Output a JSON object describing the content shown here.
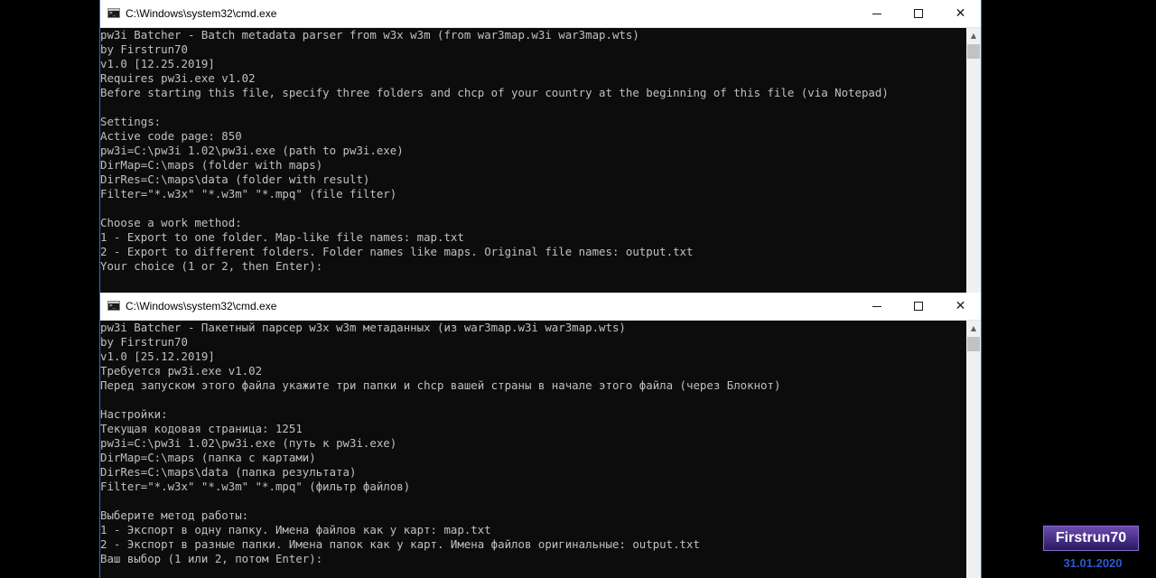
{
  "windows": [
    {
      "title": "C:\\Windows\\system32\\cmd.exe",
      "controls": {
        "minimize": "",
        "maximize": "",
        "close": "✕"
      },
      "lines": [
        "pw3i Batcher - Batch metadata parser from w3x w3m (from war3map.w3i war3map.wts)",
        "by Firstrun70",
        "v1.0 [12.25.2019]",
        "Requires pw3i.exe v1.02",
        "Before starting this file, specify three folders and chcp of your country at the beginning of this file (via Notepad)",
        "",
        "Settings:",
        "Active code page: 850",
        "pw3i=C:\\pw3i 1.02\\pw3i.exe (path to pw3i.exe)",
        "DirMap=C:\\maps (folder with maps)",
        "DirRes=C:\\maps\\data (folder with result)",
        "Filter=\"*.w3x\" \"*.w3m\" \"*.mpq\" (file filter)",
        "",
        "Choose a work method:",
        "1 - Export to one folder. Map-like file names: map.txt",
        "2 - Export to different folders. Folder names like maps. Original file names: output.txt",
        "Your choice (1 or 2, then Enter):"
      ]
    },
    {
      "title": "C:\\Windows\\system32\\cmd.exe",
      "controls": {
        "minimize": "",
        "maximize": "",
        "close": "✕"
      },
      "lines": [
        "pw3i Batcher - Пакетный парсер w3x w3m метаданных (из war3map.w3i war3map.wts)",
        "by Firstrun70",
        "v1.0 [25.12.2019]",
        "Требуется pw3i.exe v1.02",
        "Перед запуском этого файла укажите три папки и chcp вашей страны в начале этого файла (через Блокнот)",
        "",
        "Настройки:",
        "Текущая кодовая страница: 1251",
        "pw3i=C:\\pw3i 1.02\\pw3i.exe (путь к pw3i.exe)",
        "DirMap=C:\\maps (папка с картами)",
        "DirRes=C:\\maps\\data (папка результата)",
        "Filter=\"*.w3x\" \"*.w3m\" \"*.mpq\" (фильтр файлов)",
        "",
        "Выберите метод работы:",
        "1 - Экспорт в одну папку. Имена файлов как у карт: map.txt",
        "2 - Экспорт в разные папки. Имена папок как у карт. Имена файлов оригинальные: output.txt",
        "Ваш выбор (1 или 2, потом Enter):"
      ]
    }
  ],
  "scrollbar": {
    "up_arrow": "▲"
  },
  "watermark": {
    "author": "Firstrun70",
    "date": "31.01.2020"
  },
  "colors": {
    "console_bg": "#0c0c0c",
    "console_text": "#c0c0c0",
    "titlebar_bg": "#ffffff",
    "window_border": "#1e78c8",
    "watermark_bg": "#4a2a90",
    "date_text": "#2a5ad0"
  },
  "icons": {
    "window_icon": "cmd-icon",
    "minimize": "minimize-icon",
    "maximize": "maximize-icon",
    "close": "close-icon"
  }
}
